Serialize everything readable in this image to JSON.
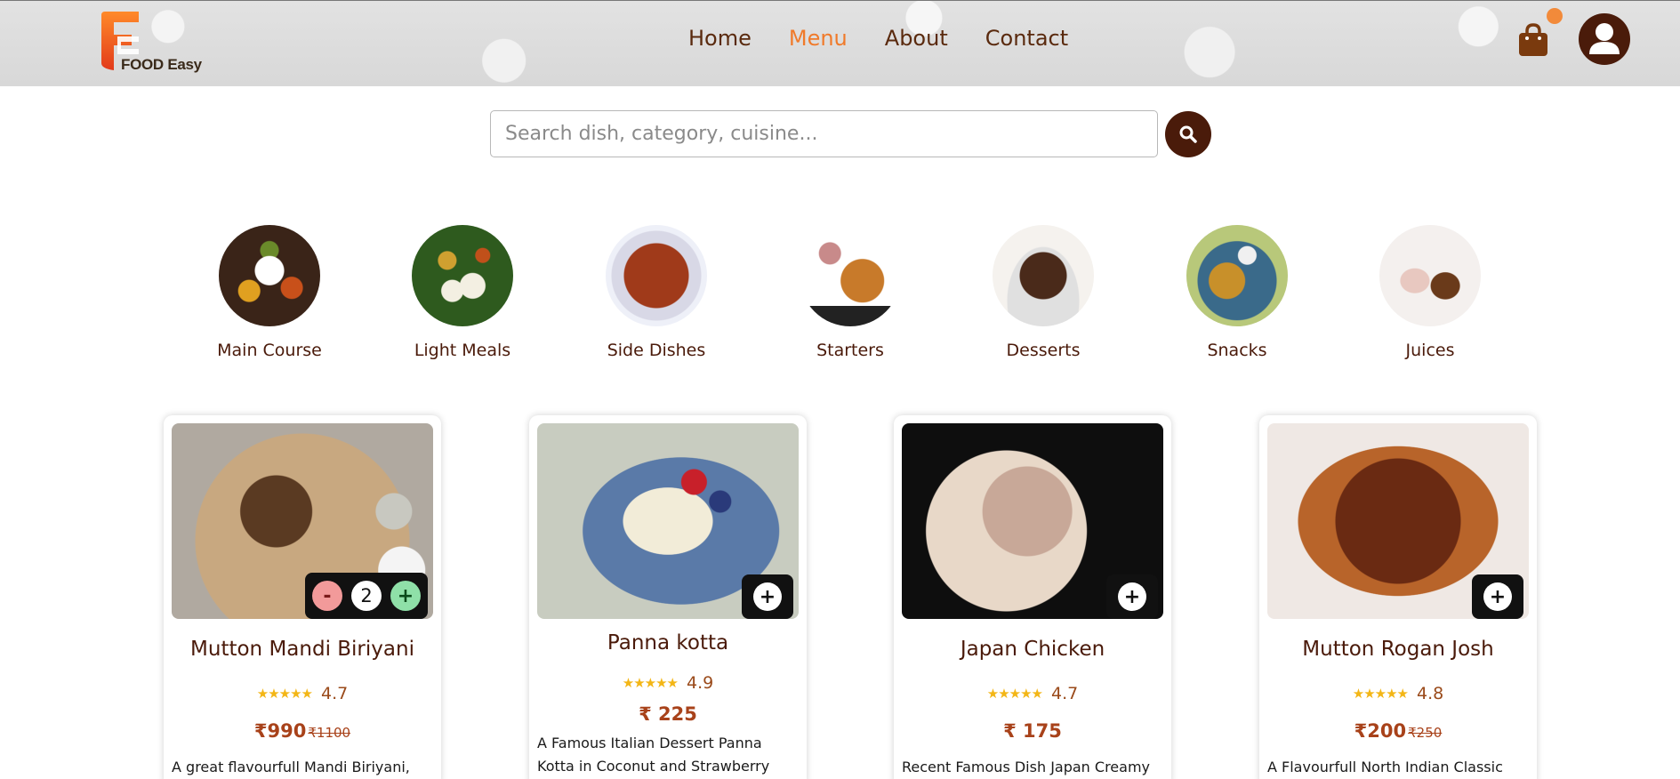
{
  "brand": {
    "name": "FOOD Easy",
    "accent": "#f07a2a",
    "dark": "#4a1b0a"
  },
  "nav": {
    "items": [
      "Home",
      "Menu",
      "About",
      "Contact"
    ],
    "active": "Menu"
  },
  "header": {
    "cart_icon": "shopping-bag-icon",
    "profile_icon": "user-icon"
  },
  "search": {
    "placeholder": "Search dish, category, cuisine...",
    "value": "",
    "button_icon": "search-icon"
  },
  "categories": [
    {
      "label": "Main Course"
    },
    {
      "label": "Light Meals"
    },
    {
      "label": "Side Dishes"
    },
    {
      "label": "Starters"
    },
    {
      "label": "Desserts"
    },
    {
      "label": "Snacks"
    },
    {
      "label": "Juices"
    }
  ],
  "products": [
    {
      "name": "Mutton Mandi Biriyani",
      "rating": "4.7",
      "price": "₹990",
      "old_price": "₹1100",
      "desc": "A great flavourfull Mandi Biriyani,",
      "qty": "2",
      "minus_label": "-",
      "plus_label": "+"
    },
    {
      "name": "Panna kotta",
      "rating": "4.9",
      "price": "₹ 225",
      "old_price": "",
      "desc_line1": "A Famous Italian Dessert Panna",
      "desc_line2": "Kotta in Coconut and Strawberry",
      "add_label": "+"
    },
    {
      "name": "Japan Chicken",
      "rating": "4.7",
      "price": "₹ 175",
      "old_price": "",
      "desc": "Recent Famous Dish Japan Creamy",
      "add_label": "+"
    },
    {
      "name": "Mutton Rogan Josh",
      "rating": "4.8",
      "price": "₹200",
      "old_price": "₹250",
      "desc": "A Flavourfull North Indian Classic",
      "add_label": "+"
    }
  ],
  "stars": "★★★★★"
}
